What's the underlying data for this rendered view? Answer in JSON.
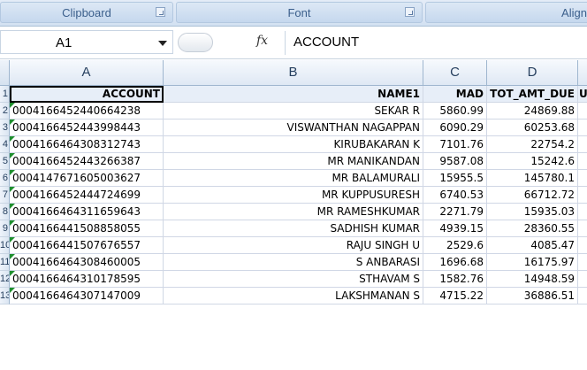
{
  "ribbon": {
    "groups": [
      {
        "label": "Clipboard"
      },
      {
        "label": "Font"
      },
      {
        "label": "Alignme"
      }
    ]
  },
  "formula_bar": {
    "name_box": "A1",
    "fx_label": "fx",
    "content": "ACCOUNT"
  },
  "grid": {
    "columns": [
      "A",
      "B",
      "C",
      "D"
    ],
    "row_numbers": [
      "1",
      "2",
      "3",
      "4",
      "5",
      "6",
      "7",
      "8",
      "9",
      "10",
      "11",
      "12",
      "13"
    ],
    "header": {
      "account": "ACCOUNT",
      "name": "NAME1",
      "mad": "MAD",
      "tot": "TOT_AMT_DUE",
      "overflow": "U"
    },
    "rows": [
      {
        "account": "0004166452440664238",
        "name": "SEKAR R",
        "mad": "5860.99",
        "tot": "24869.88"
      },
      {
        "account": "0004166452443998443",
        "name": "VISWANTHAN NAGAPPAN",
        "mad": "6090.29",
        "tot": "60253.68"
      },
      {
        "account": "0004166464308312743",
        "name": "KIRUBAKARAN K",
        "mad": "7101.76",
        "tot": "22754.2"
      },
      {
        "account": "0004166452443266387",
        "name": "MR MANIKANDAN",
        "mad": "9587.08",
        "tot": "15242.6"
      },
      {
        "account": "0004147671605003627",
        "name": "MR BALAMURALI",
        "mad": "15955.5",
        "tot": "145780.1"
      },
      {
        "account": "0004166452444724699",
        "name": "MR KUPPUSURESH",
        "mad": "6740.53",
        "tot": "66712.72"
      },
      {
        "account": "0004166464311659643",
        "name": "MR RAMESHKUMAR",
        "mad": "2271.79",
        "tot": "15935.03"
      },
      {
        "account": "0004166441508858055",
        "name": "SADHISH KUMAR",
        "mad": "4939.15",
        "tot": "28360.55"
      },
      {
        "account": "0004166441507676557",
        "name": "RAJU SINGH U",
        "mad": "2529.6",
        "tot": "4085.47"
      },
      {
        "account": "0004166464308460005",
        "name": "S ANBARASI",
        "mad": "1696.68",
        "tot": "16175.97"
      },
      {
        "account": "0004166464310178595",
        "name": "STHAVAM S",
        "mad": "1582.76",
        "tot": "14948.59"
      },
      {
        "account": "0004166464307147009",
        "name": "LAKSHMANAN S",
        "mad": "4715.22",
        "tot": "36886.51"
      }
    ]
  }
}
